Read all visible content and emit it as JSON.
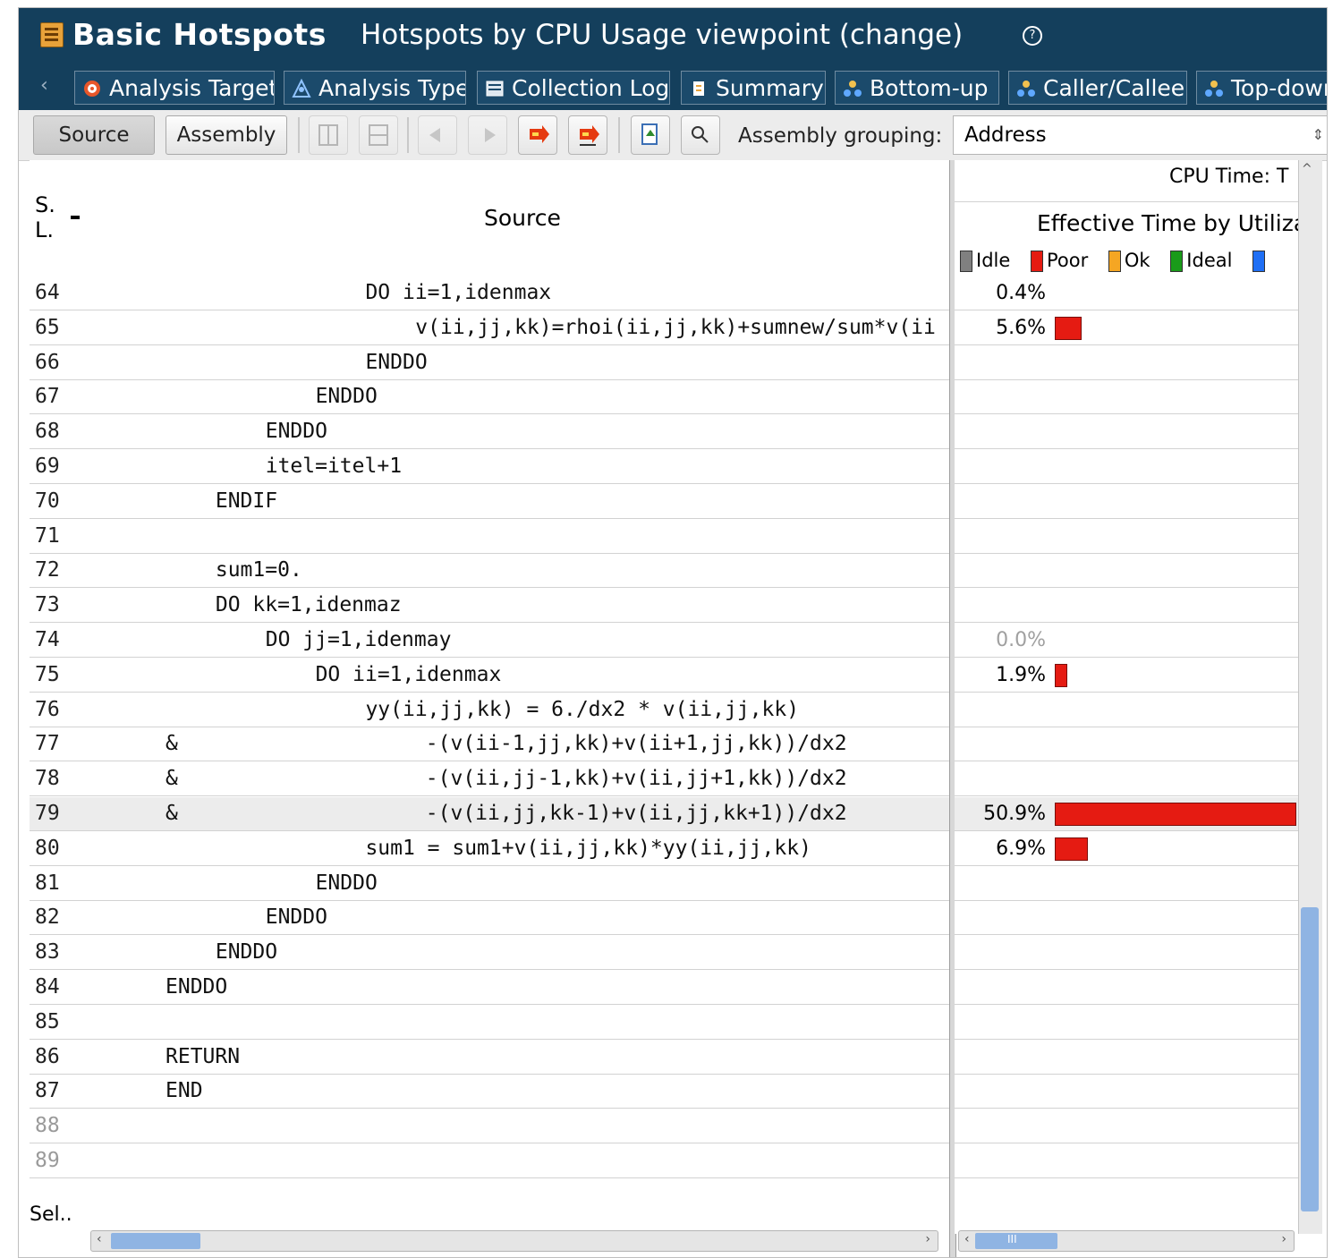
{
  "header": {
    "title": "Basic Hotspots",
    "viewpoint": "Hotspots by CPU Usage viewpoint (change)",
    "help_glyph": "?"
  },
  "tabs": [
    {
      "label": "Analysis Target",
      "icon": "target-icon"
    },
    {
      "label": "Analysis Type",
      "icon": "analysis-type-icon"
    },
    {
      "label": "Collection Log",
      "icon": "log-icon"
    },
    {
      "label": "Summary",
      "icon": "summary-icon"
    },
    {
      "label": "Bottom-up",
      "icon": "bottom-up-icon"
    },
    {
      "label": "Caller/Callee",
      "icon": "caller-callee-icon"
    },
    {
      "label": "Top-down",
      "icon": "top-down-icon"
    }
  ],
  "toolbar": {
    "source_label": "Source",
    "assembly_label": "Assembly",
    "grouping_label": "Assembly grouping:",
    "grouping_value": "Address"
  },
  "columns": {
    "line": "S.\nL.",
    "source": "Source",
    "cpu_time": "CPU Time: T",
    "effective": "Effective Time by Utiliza",
    "legend": [
      "Idle",
      "Poor",
      "Ok",
      "Ideal"
    ]
  },
  "colors": {
    "idle": "#808080",
    "poor": "#e51b12",
    "ok": "#f5a623",
    "ideal": "#1a9b1a",
    "over": "#1f6ff5",
    "titlebar": "#143f5c"
  },
  "rows": [
    {
      "line": "64",
      "indent": 12,
      "code": "DO ii=1,idenmax",
      "pct": "0.4%",
      "bar": 0
    },
    {
      "line": "65",
      "indent": 15,
      "code": "v(ii,jj,kk)=rhoi(ii,jj,kk)+sumnew/sum*v(ii",
      "pct": "5.6%",
      "bar": 5.6
    },
    {
      "line": "66",
      "indent": 12,
      "code": "ENDDO",
      "pct": "",
      "bar": 0
    },
    {
      "line": "67",
      "indent": 9,
      "code": "ENDDO",
      "pct": "",
      "bar": 0
    },
    {
      "line": "68",
      "indent": 6,
      "code": "ENDDO",
      "pct": "",
      "bar": 0
    },
    {
      "line": "69",
      "indent": 6,
      "code": "itel=itel+1",
      "pct": "",
      "bar": 0
    },
    {
      "line": "70",
      "indent": 3,
      "code": "ENDIF",
      "pct": "",
      "bar": 0
    },
    {
      "line": "71",
      "indent": 0,
      "code": "",
      "pct": "",
      "bar": 0
    },
    {
      "line": "72",
      "indent": 3,
      "code": "sum1=0.",
      "pct": "",
      "bar": 0
    },
    {
      "line": "73",
      "indent": 3,
      "code": "DO kk=1,idenmaz",
      "pct": "",
      "bar": 0
    },
    {
      "line": "74",
      "indent": 6,
      "code": "DO jj=1,idenmay",
      "pct": "0.0%",
      "bar": 0,
      "dim": true
    },
    {
      "line": "75",
      "indent": 9,
      "code": "DO ii=1,idenmax",
      "pct": "1.9%",
      "bar": 1.9
    },
    {
      "line": "76",
      "indent": 12,
      "code": "yy(ii,jj,kk) = 6./dx2 * v(ii,jj,kk)",
      "pct": "",
      "bar": 0
    },
    {
      "line": "77",
      "indent": 0,
      "code": "&                    -(v(ii-1,jj,kk)+v(ii+1,jj,kk))/dx2",
      "pct": "",
      "bar": 0
    },
    {
      "line": "78",
      "indent": 0,
      "code": "&                    -(v(ii,jj-1,kk)+v(ii,jj+1,kk))/dx2",
      "pct": "",
      "bar": 0
    },
    {
      "line": "79",
      "indent": 0,
      "code": "&                    -(v(ii,jj,kk-1)+v(ii,jj,kk+1))/dx2",
      "pct": "50.9%",
      "bar": 50.9,
      "selected": true
    },
    {
      "line": "80",
      "indent": 12,
      "code": "sum1 = sum1+v(ii,jj,kk)*yy(ii,jj,kk)",
      "pct": "6.9%",
      "bar": 6.9
    },
    {
      "line": "81",
      "indent": 9,
      "code": "ENDDO",
      "pct": "",
      "bar": 0
    },
    {
      "line": "82",
      "indent": 6,
      "code": "ENDDO",
      "pct": "",
      "bar": 0
    },
    {
      "line": "83",
      "indent": 3,
      "code": "ENDDO",
      "pct": "",
      "bar": 0
    },
    {
      "line": "84",
      "indent": 0,
      "code": "ENDDO",
      "pct": "",
      "bar": 0
    },
    {
      "line": "85",
      "indent": 0,
      "code": "",
      "pct": "",
      "bar": 0
    },
    {
      "line": "86",
      "indent": 0,
      "code": "RETURN",
      "pct": "",
      "bar": 0
    },
    {
      "line": "87",
      "indent": 0,
      "code": "END",
      "pct": "",
      "bar": 0
    },
    {
      "line": "88",
      "indent": 0,
      "code": "",
      "pct": "",
      "bar": 0,
      "dim_line": true
    },
    {
      "line": "89",
      "indent": 0,
      "code": "",
      "pct": "",
      "bar": 0,
      "dim_line": true
    }
  ],
  "footer": {
    "selection_label": "Sel.."
  },
  "scroll": {
    "horizontal_arrow_left": "‹",
    "horizontal_arrow_right": "›",
    "grip": "III",
    "up": "^"
  }
}
